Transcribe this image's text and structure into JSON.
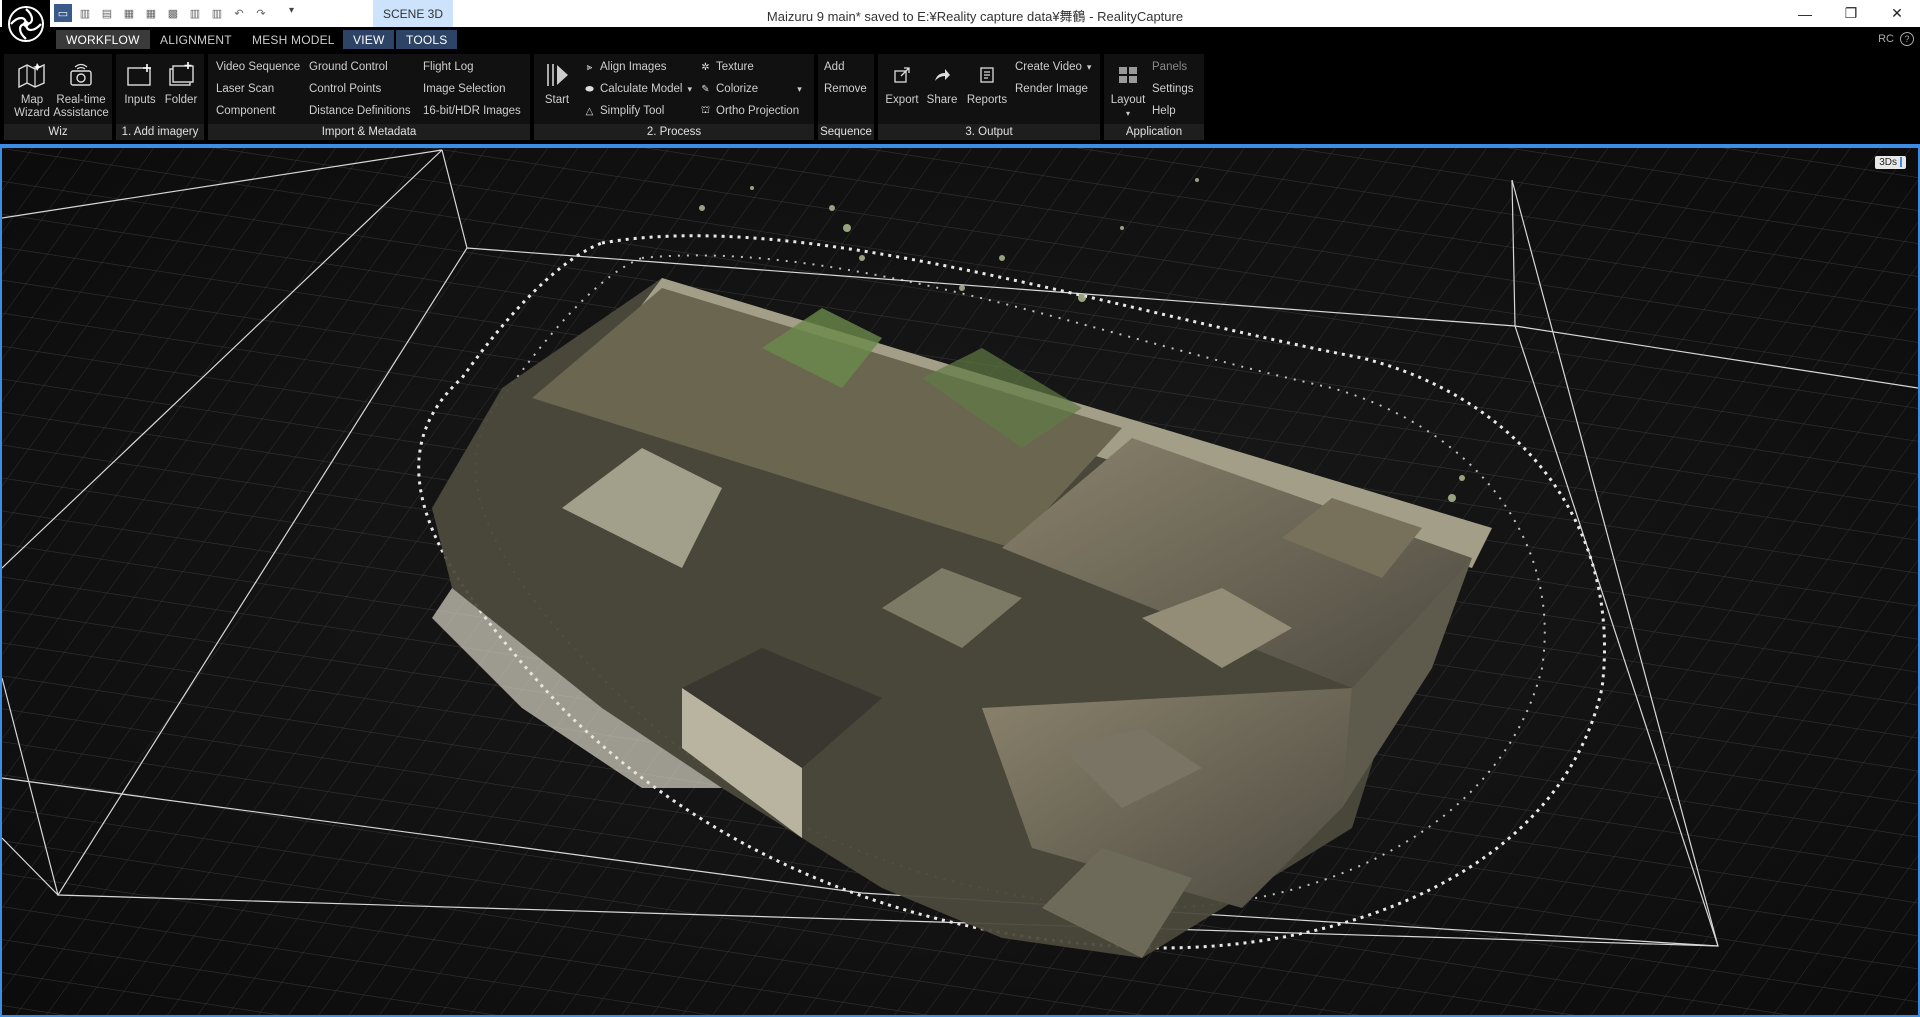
{
  "titlebar": {
    "scene_tab": "SCENE 3D",
    "title": "Maizuru 9 main* saved to E:¥Reality capture data¥舞鶴 - RealityCapture",
    "minimize": "—",
    "restore": "❐",
    "close": "✕"
  },
  "menu": {
    "tabs": [
      "WORKFLOW",
      "ALIGNMENT",
      "MESH MODEL",
      "VIEW",
      "TOOLS"
    ],
    "right_label": "RC",
    "help": "?"
  },
  "ribbon": {
    "wiz": {
      "name": "Wiz",
      "map_wizard_1": "Map",
      "map_wizard_2": "Wizard",
      "rt_1": "Real-time",
      "rt_2": "Assistance"
    },
    "add_imagery": {
      "name": "1. Add imagery",
      "inputs": "Inputs",
      "folder": "Folder"
    },
    "import_metadata": {
      "name": "Import & Metadata",
      "col1": [
        "Video Sequence",
        "Laser Scan",
        "Component"
      ],
      "col2": [
        "Ground Control",
        "Control Points",
        "Distance Definitions"
      ],
      "col3": [
        "Flight Log",
        "Image Selection",
        "16-bit/HDR Images"
      ]
    },
    "process": {
      "name": "2. Process",
      "start": "Start",
      "col1": [
        "Align Images",
        "Calculate Model",
        "Simplify Tool"
      ],
      "col2": [
        "Texture",
        "Colorize",
        "Ortho Projection"
      ]
    },
    "sequence": {
      "name": "Sequence",
      "add": "Add",
      "remove": "Remove"
    },
    "output": {
      "name": "3. Output",
      "export": "Export",
      "share": "Share",
      "reports": "Reports",
      "create_video": "Create Video",
      "render_image": "Render Image"
    },
    "application": {
      "name": "Application",
      "layout": "Layout",
      "panels": "Panels",
      "settings": "Settings",
      "help": "Help"
    }
  },
  "viewport": {
    "badge": "3Ds"
  },
  "colors": {
    "accent": "#3c8de6",
    "scene_tab": "#cde2fb",
    "ribbon_bg": "#111111",
    "group_label_bg": "#1e1e1e"
  }
}
